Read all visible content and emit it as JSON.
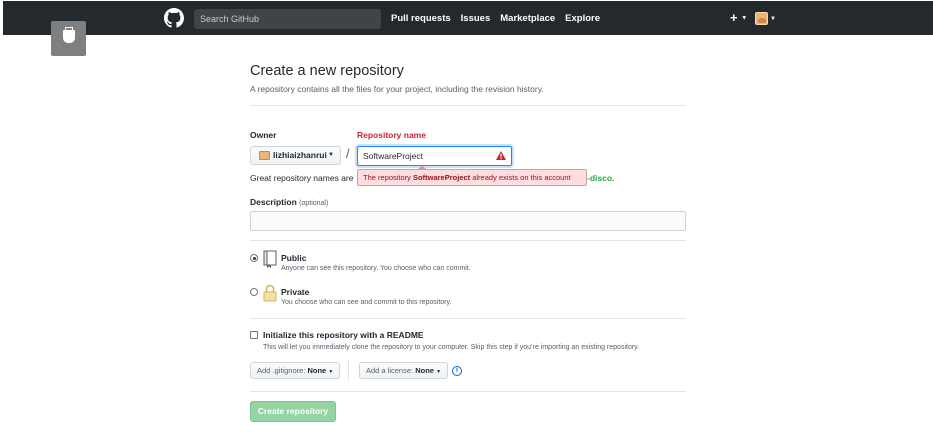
{
  "header": {
    "search_placeholder": "Search GitHub",
    "nav": [
      "Pull requests",
      "Issues",
      "Marketplace",
      "Explore"
    ],
    "plus_label": "+",
    "icons": [
      "github-logo-icon",
      "plus-icon",
      "avatar",
      "usb-icon"
    ]
  },
  "page": {
    "title": "Create a new repository",
    "subtitle": "A repository contains all the files for your project, including the revision history."
  },
  "form": {
    "owner_label": "Owner",
    "owner_value": "lizhiaizhanrui",
    "slash": "/",
    "repo_label": "Repository name",
    "repo_value": "SoftwareProject",
    "hint_text": "Great repository names are",
    "hint_tail": "-disco.",
    "error_prefix": "The repository ",
    "error_repo": "SoftwareProject",
    "error_suffix": " already exists on this account",
    "description_label": "Description",
    "description_optional": "(optional)",
    "description_value": ""
  },
  "visibility": {
    "public_title": "Public",
    "public_desc": "Anyone can see this repository. You choose who can commit.",
    "private_title": "Private",
    "private_desc": "You choose who can see and commit to this repository.",
    "selected": "public"
  },
  "init": {
    "title": "Initialize this repository with a README",
    "desc": "This will let you immediately clone the repository to your computer. Skip this step if you’re importing an existing repository.",
    "checked": false
  },
  "extras": {
    "gitignore_prefix": "Add .gitignore:",
    "gitignore_value": "None",
    "license_prefix": "Add a license:",
    "license_value": "None",
    "info_glyph": "i"
  },
  "submit": {
    "label": "Create repository",
    "disabled": true
  },
  "colors": {
    "header_bg": "#24292e",
    "error_text": "#cb2431",
    "error_bg": "#ffdce0",
    "accent_blue": "#0366d6",
    "create_button_disabled": "#94d3a2",
    "hint_green": "#28a745"
  }
}
